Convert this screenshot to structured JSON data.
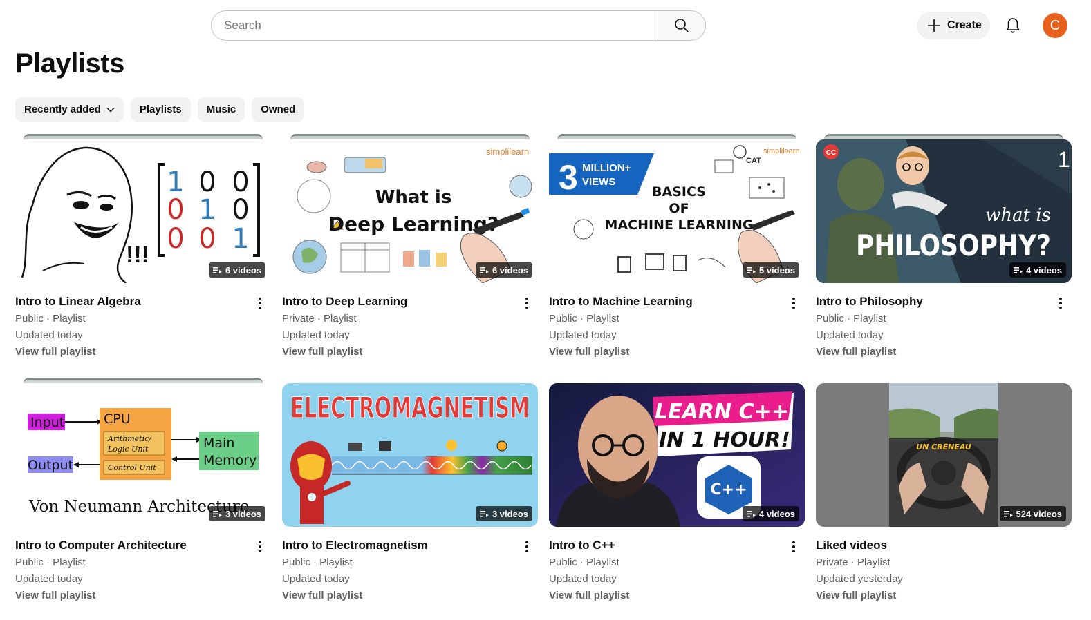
{
  "search": {
    "placeholder": "Search"
  },
  "header": {
    "create_label": "Create",
    "avatar_letter": "C",
    "avatar_color": "#e8601c"
  },
  "page": {
    "title": "Playlists"
  },
  "filters": [
    {
      "label": "Recently added",
      "has_dropdown": true
    },
    {
      "label": "Playlists"
    },
    {
      "label": "Music"
    },
    {
      "label": "Owned"
    }
  ],
  "playlists": [
    {
      "title": "Intro to Linear Algebra",
      "visibility": "Public · Playlist",
      "updated": "Updated today",
      "view_label": "View full playlist",
      "video_count": "6 videos",
      "thumb": {
        "texts": [
          "!!!",
          "1",
          "0",
          "0",
          "0",
          "1",
          "0",
          "0",
          "0",
          "1"
        ]
      }
    },
    {
      "title": "Intro to Deep Learning",
      "visibility": "Private · Playlist",
      "updated": "Updated today",
      "view_label": "View full playlist",
      "video_count": "6 videos",
      "thumb": {
        "texts": [
          "simplilearn",
          "What is",
          "Deep Learning?"
        ]
      }
    },
    {
      "title": "Intro to Machine Learning",
      "visibility": "Public · Playlist",
      "updated": "Updated today",
      "view_label": "View full playlist",
      "video_count": "5 videos",
      "thumb": {
        "texts": [
          "3",
          "MILLION+",
          "VIEWS",
          "BASICS",
          "OF",
          "MACHINE LEARNING",
          "CAT",
          "simplilearn"
        ]
      }
    },
    {
      "title": "Intro to Philosophy",
      "visibility": "Public · Playlist",
      "updated": "Updated today",
      "view_label": "View full playlist",
      "video_count": "4 videos",
      "thumb": {
        "texts": [
          "CC",
          "1",
          "what is",
          "PHILOSOPHY?"
        ]
      }
    },
    {
      "title": "Intro to Computer Architecture",
      "visibility": "Public · Playlist",
      "updated": "Updated today",
      "view_label": "View full playlist",
      "video_count": "3 videos",
      "thumb": {
        "texts": [
          "Input",
          "CPU",
          "Arithmetic/",
          "Logic Unit",
          "Control Unit",
          "Main",
          "Memory",
          "Output",
          "Von Neumann Architecture"
        ]
      }
    },
    {
      "title": "Intro to Electromagnetism",
      "visibility": "Public · Playlist",
      "updated": "Updated today",
      "view_label": "View full playlist",
      "video_count": "3 videos",
      "thumb": {
        "texts": [
          "ELECTROMAGNETISM"
        ]
      }
    },
    {
      "title": "Intro to C++",
      "visibility": "Public · Playlist",
      "updated": "Updated today",
      "view_label": "View full playlist",
      "video_count": "4 videos",
      "thumb": {
        "texts": [
          "LEARN C++",
          "IN 1 HOUR!",
          "C++"
        ]
      }
    },
    {
      "title": "Liked videos",
      "visibility": "Private · Playlist",
      "updated": "Updated yesterday",
      "view_label": "View full playlist",
      "video_count": "524 videos",
      "thumb": {
        "texts": [
          "UN CRÉNEAU"
        ]
      }
    }
  ]
}
